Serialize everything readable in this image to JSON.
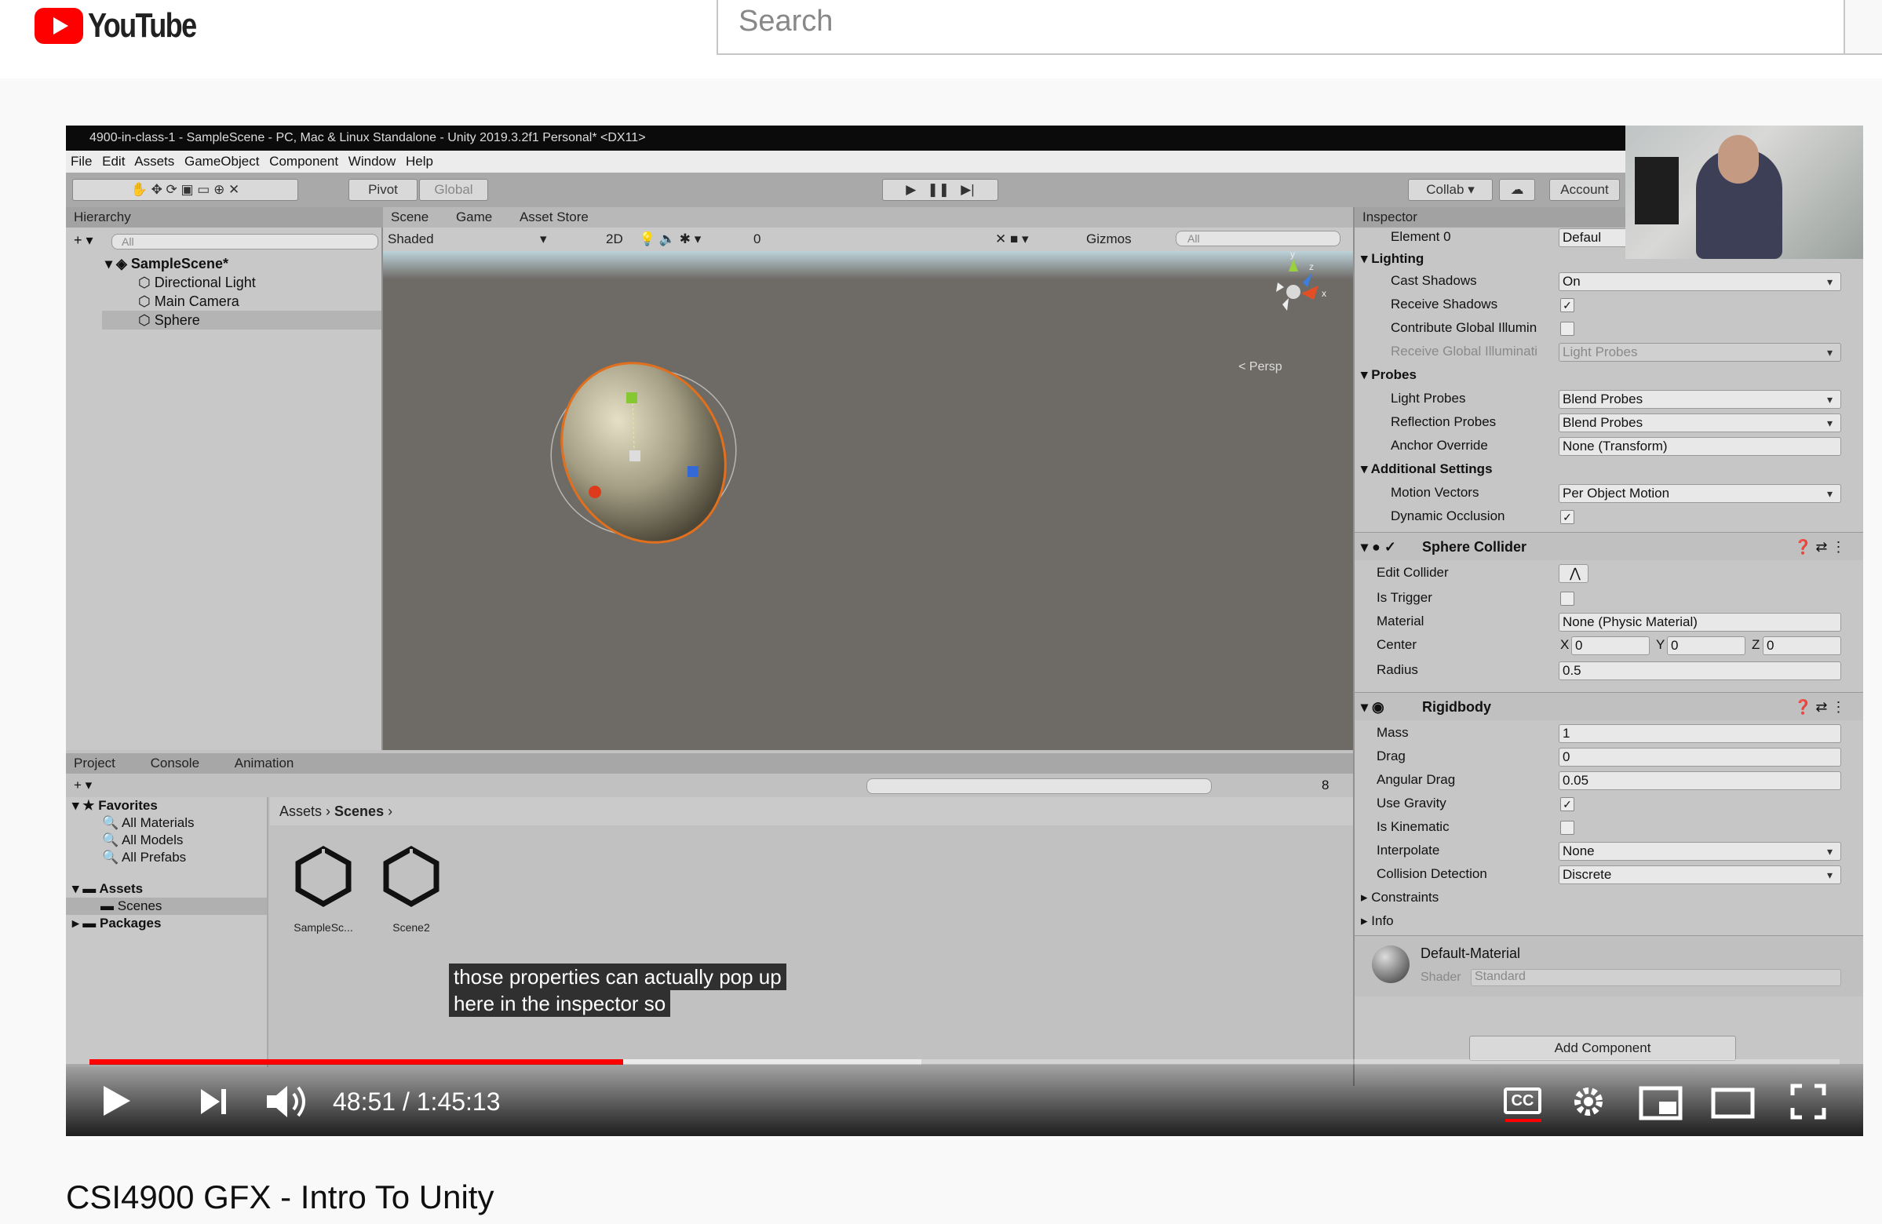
{
  "youtube": {
    "logo_text": "YouTube",
    "search_placeholder": "Search"
  },
  "unity": {
    "title_bar": "4900-in-class-1 - SampleScene - PC, Mac & Linux Standalone - Unity 2019.3.2f1 Personal* <DX11>",
    "menu": [
      "File",
      "Edit",
      "Assets",
      "GameObject",
      "Component",
      "Window",
      "Help"
    ],
    "toolbar": {
      "pivot": "Pivot",
      "global": "Global",
      "collab": "Collab",
      "account": "Account"
    },
    "hierarchy": {
      "tab": "Hierarchy",
      "search": "All",
      "scene": "SampleScene*",
      "items": [
        "Directional Light",
        "Main Camera",
        "Sphere"
      ]
    },
    "scene_view": {
      "tabs": [
        "Scene",
        "Game",
        "Asset Store"
      ],
      "shading": "Shaded",
      "mode_2d": "2D",
      "fx_count": "0",
      "gizmos": "Gizmos",
      "search": "All",
      "persp": "< Persp",
      "axis_y": "y",
      "axis_z": "z",
      "axis_x": "x"
    },
    "project": {
      "tabs": [
        "Project",
        "Console",
        "Animation"
      ],
      "favorites": "Favorites",
      "favorite_items": [
        "All Materials",
        "All Models",
        "All Prefabs"
      ],
      "assets": "Assets",
      "scenes_folder": "Scenes",
      "packages": "Packages",
      "breadcrumb": [
        "Assets",
        "Scenes"
      ],
      "files": [
        "SampleSc...",
        "Scene2"
      ],
      "hidden_count": "8"
    },
    "inspector": {
      "tab": "Inspector",
      "element0_label": "Element 0",
      "element0_value": "Defaul",
      "lighting": "Lighting",
      "cast_shadows_label": "Cast Shadows",
      "cast_shadows": "On",
      "receive_shadows_label": "Receive Shadows",
      "contribute_gi_label": "Contribute Global Illumin",
      "receive_gi_label": "Receive Global Illuminati",
      "receive_gi": "Light Probes",
      "probes": "Probes",
      "light_probes_label": "Light Probes",
      "light_probes": "Blend Probes",
      "reflection_probes_label": "Reflection Probes",
      "reflection_probes": "Blend Probes",
      "anchor_override_label": "Anchor Override",
      "anchor_override": "None (Transform)",
      "additional": "Additional Settings",
      "motion_vectors_label": "Motion Vectors",
      "motion_vectors": "Per Object Motion",
      "dynamic_occlusion_label": "Dynamic Occlusion",
      "sphere_collider": "Sphere Collider",
      "edit_collider_label": "Edit Collider",
      "is_trigger_label": "Is Trigger",
      "material_label": "Material",
      "material": "None (Physic Material)",
      "center_label": "Center",
      "center_x_label": "X",
      "center_x": "0",
      "center_y_label": "Y",
      "center_y": "0",
      "center_z_label": "Z",
      "center_z": "0",
      "radius_label": "Radius",
      "radius": "0.5",
      "rigidbody": "Rigidbody",
      "mass_label": "Mass",
      "mass": "1",
      "drag_label": "Drag",
      "drag": "0",
      "angular_drag_label": "Angular Drag",
      "angular_drag": "0.05",
      "use_gravity_label": "Use Gravity",
      "is_kinematic_label": "Is Kinematic",
      "interpolate_label": "Interpolate",
      "interpolate": "None",
      "collision_detection_label": "Collision Detection",
      "collision_detection": "Discrete",
      "constraints": "Constraints",
      "info": "Info",
      "default_material": "Default-Material",
      "shader_label": "Shader",
      "shader": "Standard",
      "add_component": "Add Component"
    }
  },
  "player": {
    "caption_line1": "those properties can actually pop up",
    "caption_line2": "here in the inspector so",
    "current_time": "48:51",
    "total_time": "1:45:13",
    "time_display": "48:51 / 1:45:13",
    "progress": 0.305,
    "cc_label": "CC",
    "accent": "#ff0000"
  },
  "video_title": "CSI4900 GFX - Intro To Unity"
}
